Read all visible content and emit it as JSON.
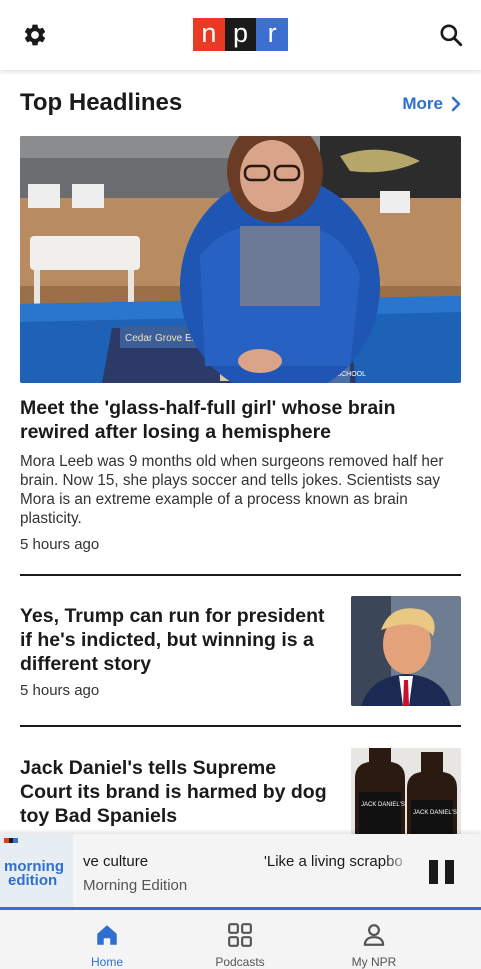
{
  "header": {
    "logo_letters": [
      "n",
      "p",
      "r"
    ],
    "brand_colors": {
      "n": "#e93b24",
      "p": "#1a1a1a",
      "r": "#3d6fd1"
    },
    "left_icon": "gear-icon",
    "right_icon": "search-icon"
  },
  "section": {
    "title": "Top Headlines",
    "more_label": "More"
  },
  "hero": {
    "title": "Meet the 'glass-half-full girl' whose brain rewired after losing a hemisphere",
    "description": "Mora Leeb was 9 months old when surgeons removed half her brain. Now 15, she plays soccer and tells jokes. Scientists say Mora is an extreme example of a process known as brain plasticity.",
    "time": "5 hours ago",
    "image_poster_text": "Cedar Grove Ele",
    "image_book_text": "NORTH END SCHOOL"
  },
  "stories": [
    {
      "title": "Yes, Trump can run for president if he's indicted, but winning is a different story",
      "time": "5 hours ago"
    },
    {
      "title": "Jack Daniel's tells Supreme Court its brand is harmed by dog toy Bad Spaniels",
      "image_label_1": "JACK DANIEL'S",
      "image_label_2": "JACK DANIEL'S"
    }
  ],
  "player": {
    "art_line1": "morning",
    "art_line2": "edition",
    "track_left": "ve culture",
    "track_right": "'Like a living scrapbo",
    "show": "Morning Edition"
  },
  "nav": {
    "items": [
      {
        "label": "Home",
        "icon": "home-icon",
        "active": true
      },
      {
        "label": "Podcasts",
        "icon": "grid-icon",
        "active": false
      },
      {
        "label": "My NPR",
        "icon": "person-icon",
        "active": false
      }
    ],
    "active_color": "#2f6fd0"
  }
}
